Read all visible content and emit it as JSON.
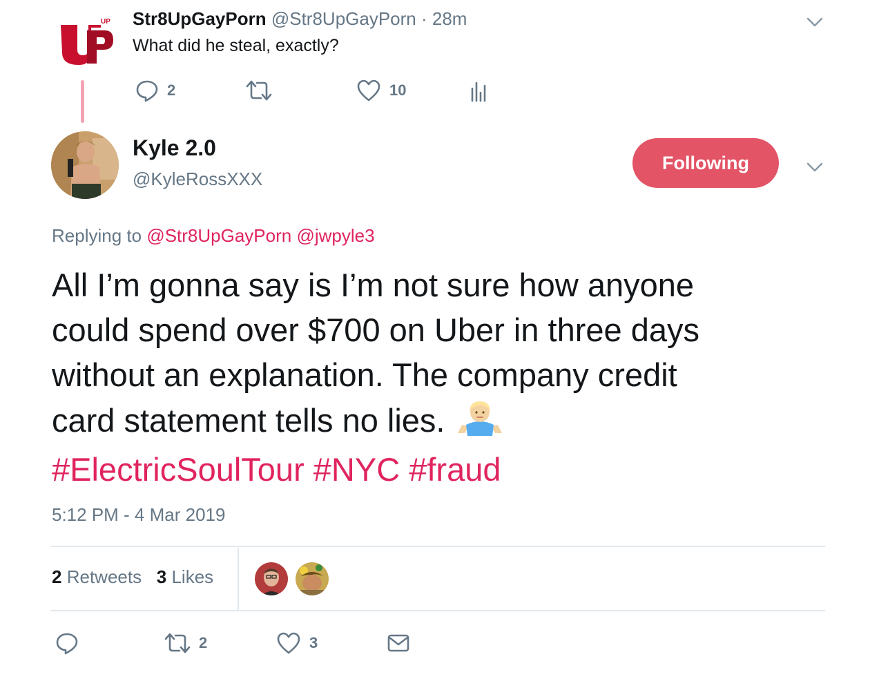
{
  "parent_tweet": {
    "display_name": "Str8UpGayPorn",
    "handle": "@Str8UpGayPorn",
    "time": "· 28m",
    "text": "What did he steal, exactly?",
    "avatar_label": "UP",
    "reply_count": "2",
    "retweet_count": "",
    "like_count": "10"
  },
  "main_tweet": {
    "display_name": "Kyle 2.0",
    "handle": "@KyleRossXXX",
    "follow_label": "Following",
    "replying_prefix": "Replying to",
    "replying_to": [
      "@Str8UpGayPorn",
      "@jwpyle3"
    ],
    "body_lines": [
      "All I’m gonna say is I’m not sure how anyone",
      "could spend over $700 on Uber in three days",
      "without an explanation. The company credit",
      "card statement tells no lies."
    ],
    "hashtags": [
      "#ElectricSoulTour",
      "#NYC",
      "#fraud"
    ],
    "timestamp": "5:12 PM - 4 Mar 2019",
    "stats": {
      "retweets_count": "2",
      "retweets_label": "Retweets",
      "likes_count": "3",
      "likes_label": "Likes"
    },
    "actions": {
      "retweet_count": "2",
      "like_count": "3"
    }
  },
  "colors": {
    "accent": "#e0245e",
    "follow_button": "#e25466",
    "muted": "#657786",
    "text": "#14171a",
    "divider": "#e1e8ed",
    "thread_line": "#f4a3b4"
  },
  "icons": [
    "reply-icon",
    "retweet-icon",
    "like-icon",
    "analytics-icon",
    "direct-message-icon",
    "chevron-down-icon",
    "shrug-emoji-icon"
  ]
}
